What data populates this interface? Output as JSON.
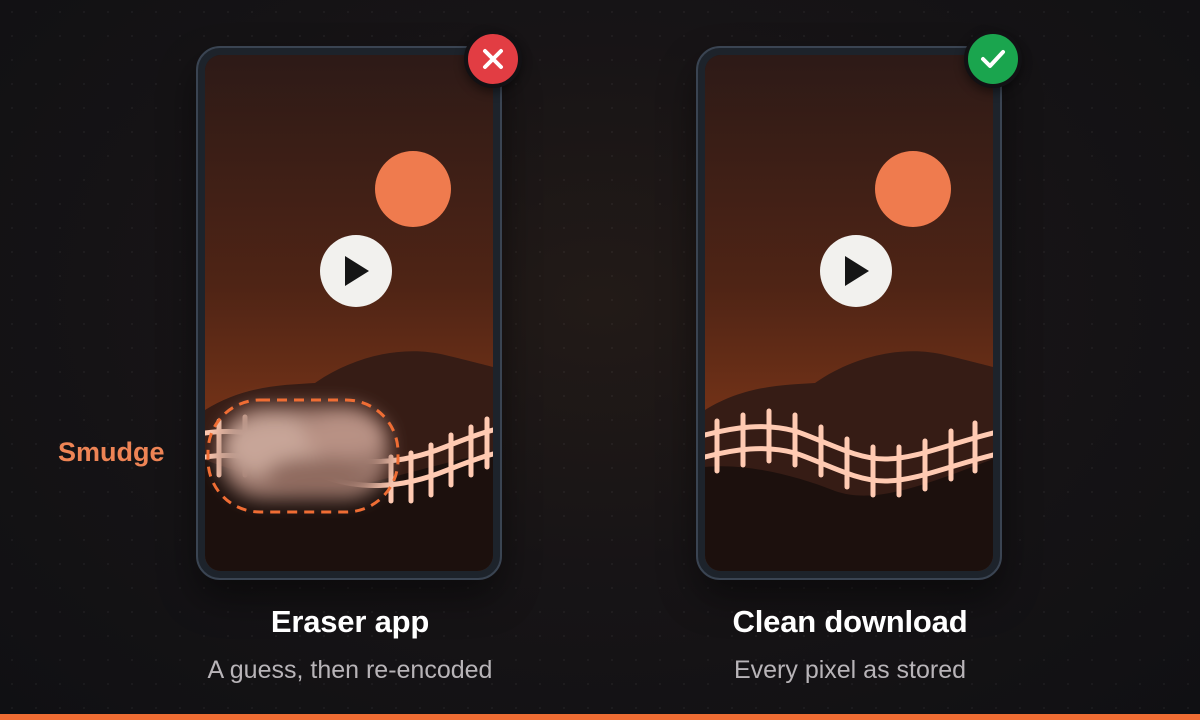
{
  "left": {
    "title": "Eraser app",
    "subtitle": "A guess, then re-encoded",
    "badge_icon": "close-icon",
    "badge_color": "#e23d43",
    "callout_label": "Smudge"
  },
  "right": {
    "title": "Clean download",
    "subtitle": "Every pixel as stored",
    "badge_icon": "check-icon",
    "badge_color": "#1aa54e"
  },
  "colors": {
    "accent": "#ef6d34",
    "sun": "#ef7b4e",
    "fence": "#ffd2bf",
    "background": "#111114"
  }
}
